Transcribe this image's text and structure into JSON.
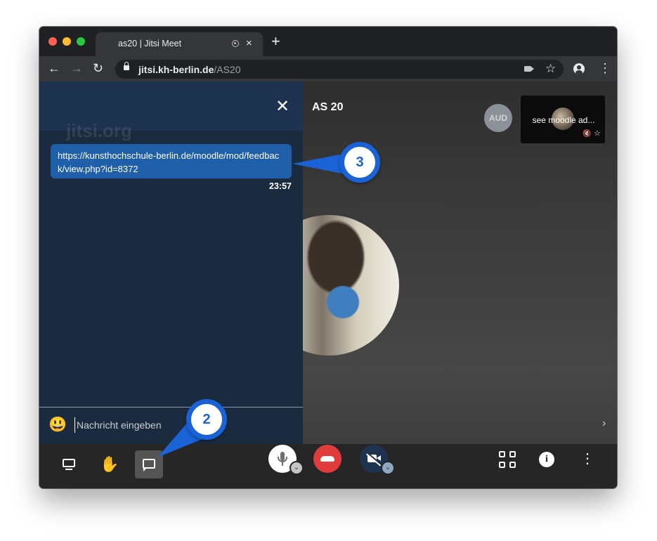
{
  "browser": {
    "tab_title": "as20 | Jitsi Meet",
    "close_tab_glyph": "×",
    "new_tab_glyph": "+",
    "back_glyph": "←",
    "forward_glyph": "→",
    "reload_glyph": "↻",
    "url_domain": "jitsi.kh-berlin.de",
    "url_path": "/AS20",
    "star_glyph": "☆",
    "menu_glyph": "⋮"
  },
  "chat": {
    "watermark": "jitsi.org",
    "close_glyph": "✕",
    "messages": [
      {
        "text": "https://kunsthochschule-berlin.de/moodle/mod/feedback/view.php?id=8372",
        "time": "23:57"
      }
    ],
    "emoji": "😃",
    "input_placeholder": "Nachricht eingeben"
  },
  "conference": {
    "room_title": "AS 20",
    "aud_avatar_initials": "AUD",
    "thumbnail_name": "see moodle ad...",
    "thumbnail_mute_glyph": "🔇",
    "thumbnail_star_glyph": "☆",
    "filmstrip_toggle_glyph": "›"
  },
  "toolbar": {
    "hand_glyph": "✋",
    "caret_glyph": "⌄",
    "info_glyph": "i",
    "more_glyph": "⋮"
  },
  "callouts": [
    "3",
    "2"
  ],
  "colors": {
    "chat_panel": "#1b2b3f",
    "message_bubble": "#1f5ea8",
    "hangup": "#e03c3c",
    "callout_blue": "#1a63d6"
  },
  "icons": [
    "record-icon",
    "lock-icon",
    "camera-icon",
    "star-icon",
    "profile-icon",
    "desktop-share-icon",
    "raise-hand-icon",
    "chat-icon",
    "microphone-icon",
    "hangup-icon",
    "video-off-icon",
    "tile-view-icon",
    "info-icon",
    "more-icon"
  ]
}
